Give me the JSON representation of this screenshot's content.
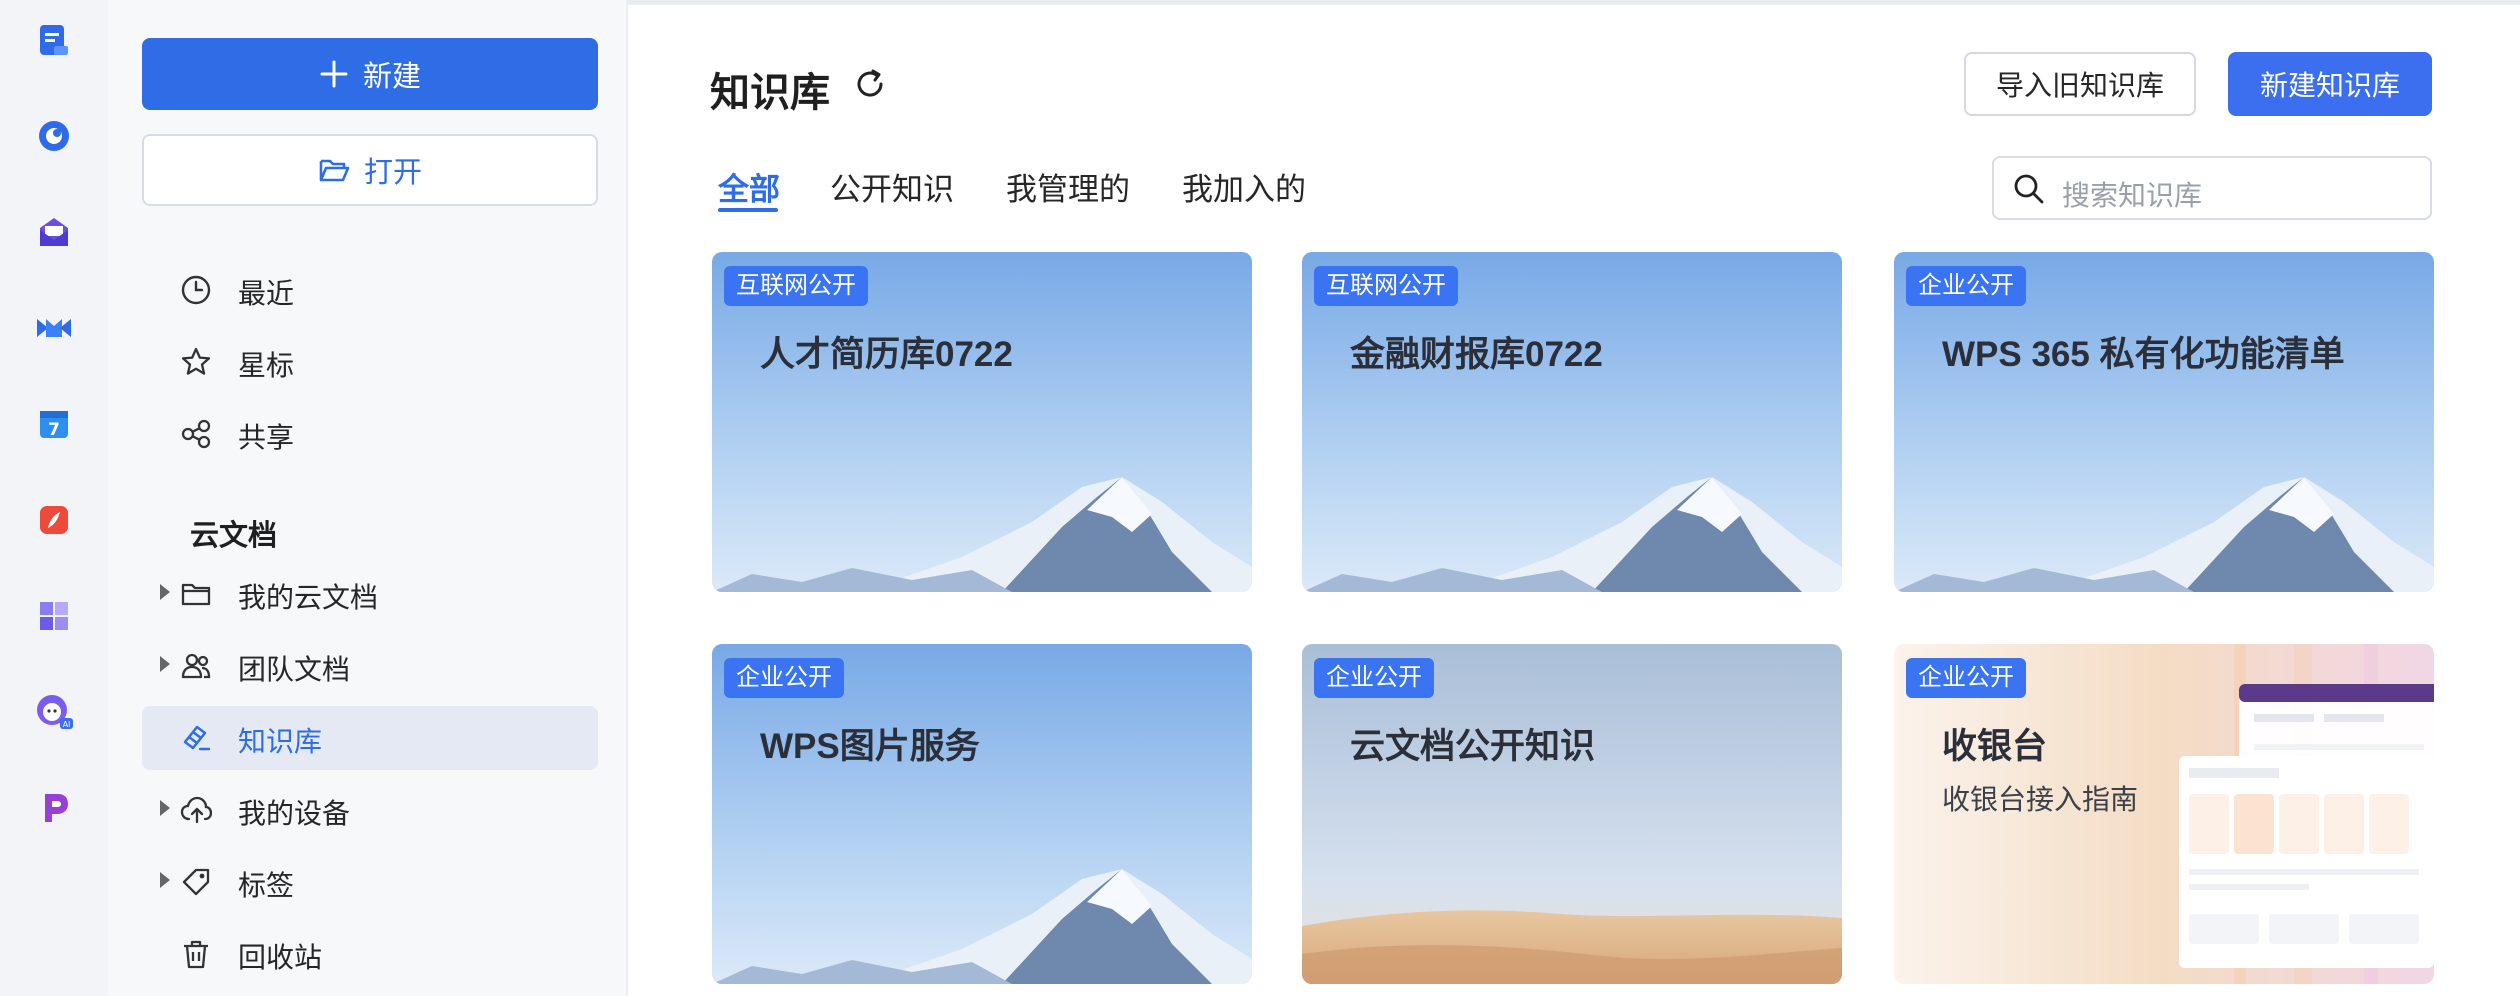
{
  "rail": {
    "icons": [
      "docs-app-icon",
      "chat-app-icon",
      "mail-app-icon",
      "meeting-app-icon",
      "calendar-app-icon",
      "pdf-app-icon",
      "apps-grid-icon",
      "ai-assistant-icon",
      "presentation-app-icon"
    ]
  },
  "sidebar": {
    "new_label": "新建",
    "open_label": "打开",
    "items_top": [
      {
        "label": "最近",
        "icon": "clock-icon"
      },
      {
        "label": "星标",
        "icon": "star-icon"
      },
      {
        "label": "共享",
        "icon": "share-icon"
      }
    ],
    "section_title": "云文档",
    "items_cloud": [
      {
        "label": "我的云文档",
        "icon": "folder-icon",
        "expandable": true
      },
      {
        "label": "团队文档",
        "icon": "team-icon",
        "expandable": true
      },
      {
        "label": "知识库",
        "icon": "knowledge-icon",
        "expandable": false,
        "active": true
      },
      {
        "label": "我的设备",
        "icon": "cloud-upload-icon",
        "expandable": true
      },
      {
        "label": "标签",
        "icon": "tag-icon",
        "expandable": true
      },
      {
        "label": "回收站",
        "icon": "trash-icon",
        "expandable": false
      }
    ]
  },
  "header": {
    "title": "知识库",
    "import_label": "导入旧知识库",
    "create_label": "新建知识库"
  },
  "tabs": [
    {
      "label": "全部",
      "active": true
    },
    {
      "label": "公开知识",
      "active": false
    },
    {
      "label": "我管理的",
      "active": false
    },
    {
      "label": "我加入的",
      "active": false
    }
  ],
  "search": {
    "placeholder": "搜索知识库"
  },
  "cards": [
    {
      "badge": "互联网公开",
      "title": "人才简历库0722",
      "subtitle": "",
      "cover": "mountain"
    },
    {
      "badge": "互联网公开",
      "title": "金融财报库0722",
      "subtitle": "",
      "cover": "mountain"
    },
    {
      "badge": "企业公开",
      "title": "WPS 365 私有化功能清单",
      "subtitle": "",
      "cover": "mountain"
    },
    {
      "badge": "企业公开",
      "title": "WPS图片服务",
      "subtitle": "",
      "cover": "mountain"
    },
    {
      "badge": "企业公开",
      "title": "云文档公开知识",
      "subtitle": "",
      "cover": "desert"
    },
    {
      "badge": "企业公开",
      "title": "收银台",
      "subtitle": "收银台接入指南",
      "cover": "dashboard"
    }
  ],
  "colors": {
    "accent": "#2e6de6",
    "badge": "#3b74f2",
    "primary_button": "#3b6ff0"
  }
}
